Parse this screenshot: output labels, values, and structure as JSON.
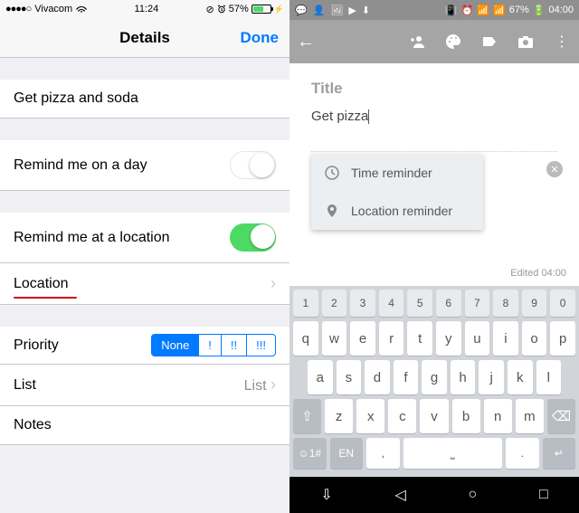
{
  "ios": {
    "carrier": "Vivacom",
    "time": "11:24",
    "battery": "57%",
    "nav_title": "Details",
    "done": "Done",
    "reminder_text": "Get pizza and soda",
    "remind_day": "Remind me on a day",
    "remind_loc": "Remind me at a location",
    "location": "Location",
    "priority_label": "Priority",
    "priority_opts": [
      "None",
      "!",
      "!!",
      "!!!"
    ],
    "list_label": "List",
    "list_value": "List",
    "notes": "Notes"
  },
  "android": {
    "battery": "67%",
    "time": "04:00",
    "title_placeholder": "Title",
    "note_text": "Get pizza",
    "popup": {
      "time": "Time reminder",
      "location": "Location reminder"
    },
    "edited": "Edited 04:00",
    "keys_num": [
      "1",
      "2",
      "3",
      "4",
      "5",
      "6",
      "7",
      "8",
      "9",
      "0"
    ],
    "keys_r1": [
      "q",
      "w",
      "e",
      "r",
      "t",
      "y",
      "u",
      "i",
      "o",
      "p"
    ],
    "keys_r2": [
      "a",
      "s",
      "d",
      "f",
      "g",
      "h",
      "j",
      "k",
      "l"
    ],
    "keys_r3": [
      "z",
      "x",
      "c",
      "v",
      "b",
      "n",
      "m"
    ]
  }
}
